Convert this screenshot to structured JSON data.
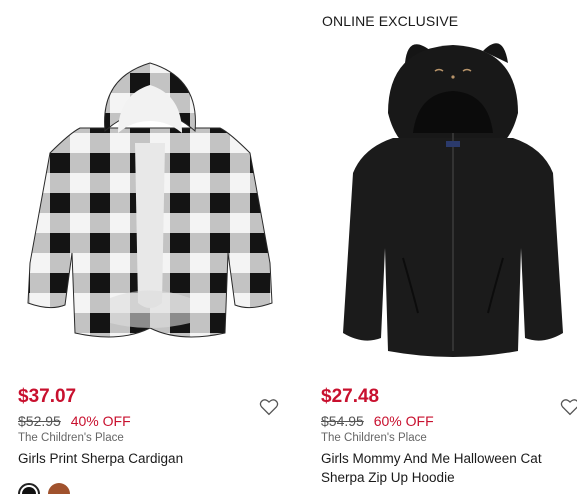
{
  "products": [
    {
      "price": "$37.07",
      "original_price": "$52.95",
      "discount": "40% OFF",
      "brand": "The Children's Place",
      "name": "Girls Print Sherpa Cardigan",
      "swatch_colors": [
        "#111111",
        "#a0522d"
      ]
    },
    {
      "badge": "ONLINE EXCLUSIVE",
      "price": "$27.48",
      "original_price": "$54.95",
      "discount": "60% OFF",
      "brand": "The Children's Place",
      "name": "Girls Mommy And Me Halloween Cat Sherpa Zip Up Hoodie"
    }
  ],
  "colors": {
    "sale_red": "#c8102e"
  },
  "icons": {
    "favorite": "heart-outline-icon"
  }
}
